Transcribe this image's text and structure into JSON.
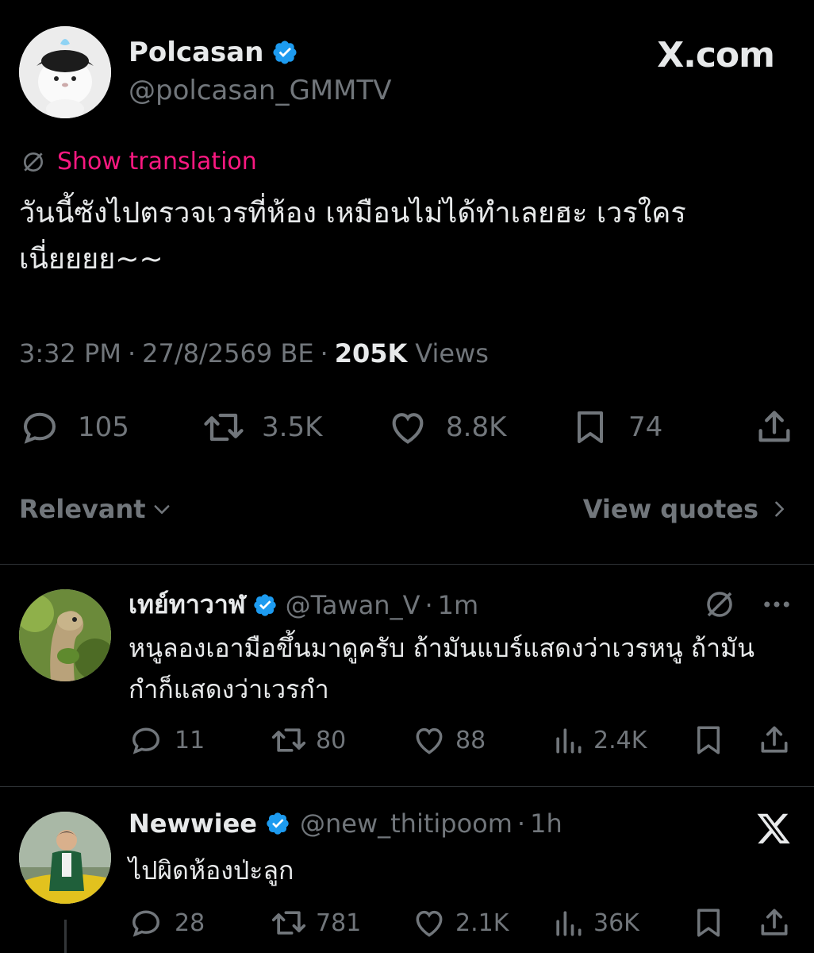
{
  "brand": {
    "site": "X.com"
  },
  "tweet": {
    "author_name": "Polcasan",
    "author_handle": "@polcasan_GMMTV",
    "show_translation": "Show translation",
    "text": "วันนี้ซังไปตรวจเวรที่ห้อง เหมือนไม่ได้ทำเลยฮะ เวรใคร เนี่ยยยย~~",
    "time": "3:32 PM",
    "date": "27/8/2569 BE",
    "views_count": "205K",
    "views_label": "Views",
    "replies": "105",
    "reposts": "3.5K",
    "likes": "8.8K",
    "bookmarks": "74"
  },
  "sort": {
    "label": "Relevant",
    "view_quotes": "View quotes"
  },
  "replies": [
    {
      "name": "เทย์ทาวาฬ",
      "handle": "@Tawan_V",
      "time": "1m",
      "text": "หนูลองเอามือขึ้นมาดูครับ ถ้ามันแบร์แสดงว่าเวรหนู ถ้ามันกำก็แสดงว่าเวรกำ",
      "replies": "11",
      "reposts": "80",
      "likes": "88",
      "views": "2.4K"
    },
    {
      "name": "Newwiee",
      "handle": "@new_thitipoom",
      "time": "1h",
      "text": "ไปผิดห้องป่ะลูก",
      "replies": "28",
      "reposts": "781",
      "likes": "2.1K",
      "views": "36K"
    }
  ],
  "colors": {
    "background": "#000000",
    "text": "#e7e9ea",
    "muted": "#71767b",
    "accent_pink": "#f91880",
    "verified_blue": "#1d9bf0"
  }
}
